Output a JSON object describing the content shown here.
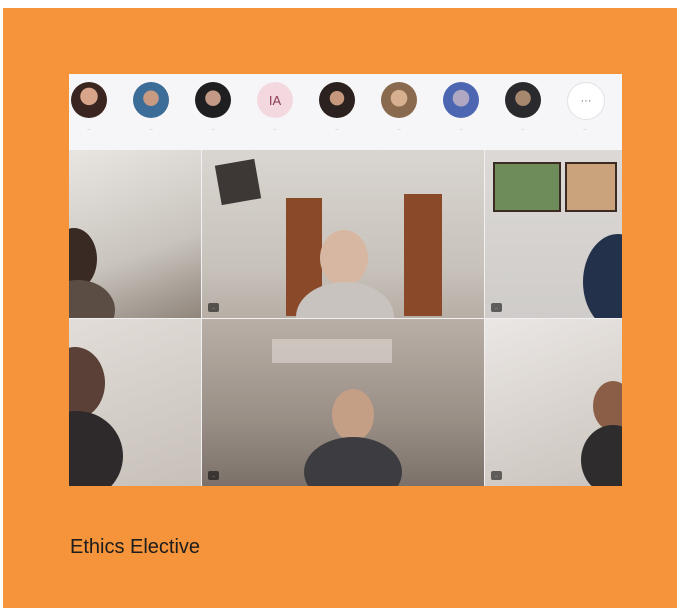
{
  "caption": "Ethics Elective",
  "participants": [
    {
      "name": "...",
      "avatar": "avatar-photo"
    },
    {
      "name": "...",
      "avatar": "avatar-photo"
    },
    {
      "name": "...",
      "avatar": "avatar-photo"
    },
    {
      "name": "...",
      "initials": "IA",
      "avatar": "initials"
    },
    {
      "name": "...",
      "avatar": "avatar-photo"
    },
    {
      "name": "...",
      "avatar": "avatar-photo"
    },
    {
      "name": "...",
      "avatar": "avatar-photo"
    },
    {
      "name": "...",
      "avatar": "avatar-photo"
    },
    {
      "name": "...",
      "more": "···",
      "avatar": "more-icon"
    }
  ],
  "tiles": [
    {
      "label": ""
    },
    {
      "label": "..."
    },
    {
      "label": "..."
    },
    {
      "label": ""
    },
    {
      "label": "..."
    },
    {
      "label": "..."
    }
  ],
  "colors": {
    "card_background": "#f5943a",
    "caption_text": "#1d1d1d"
  }
}
